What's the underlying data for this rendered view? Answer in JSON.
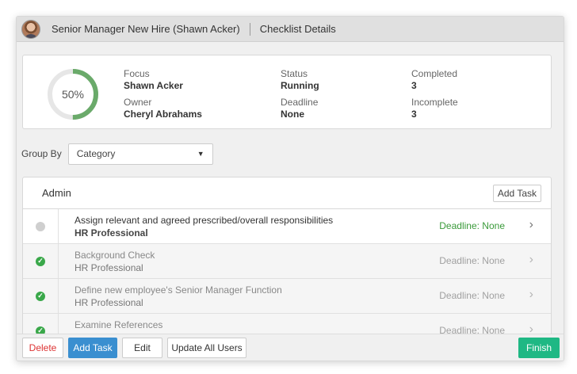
{
  "titlebar": {
    "title": "Senior Manager New Hire (Shawn Acker)",
    "subtitle": "Checklist Details"
  },
  "summary": {
    "progress_percent": 50,
    "progress_label": "50%",
    "progress_color": "#6aaa6a",
    "focus_label": "Focus",
    "focus_value": "Shawn Acker",
    "owner_label": "Owner",
    "owner_value": "Cheryl Abrahams",
    "status_label": "Status",
    "status_value": "Running",
    "deadline_label": "Deadline",
    "deadline_value": "None",
    "completed_label": "Completed",
    "completed_value": "3",
    "incomplete_label": "Incomplete",
    "incomplete_value": "3"
  },
  "groupby": {
    "label": "Group By",
    "selected": "Category",
    "caret": "▼"
  },
  "tasks": {
    "title": "Admin",
    "add_task_label": "Add Task",
    "items": [
      {
        "name": "Assign relevant and agreed prescribed/overall responsibilities",
        "role": "HR Professional",
        "deadline": "Deadline: None",
        "done": false
      },
      {
        "name": "Background Check",
        "role": "HR Professional",
        "deadline": "Deadline: None",
        "done": true
      },
      {
        "name": "Define new employee's Senior Manager Function",
        "role": "HR Professional",
        "deadline": "Deadline: None",
        "done": true
      },
      {
        "name": "Examine References",
        "role": "",
        "deadline": "Deadline: None",
        "done": true
      }
    ]
  },
  "footer": {
    "delete_label": "Delete",
    "add_task_label": "Add Task",
    "edit_label": "Edit",
    "update_all_label": "Update All Users",
    "finish_label": "Finish"
  },
  "icons": {
    "check": "✓",
    "chevron": "›"
  },
  "colors": {
    "accent_blue": "#3a8fd0",
    "finish_green": "#1fb884",
    "delete_red": "#d33333",
    "deadline_green": "#3a9a3a"
  }
}
